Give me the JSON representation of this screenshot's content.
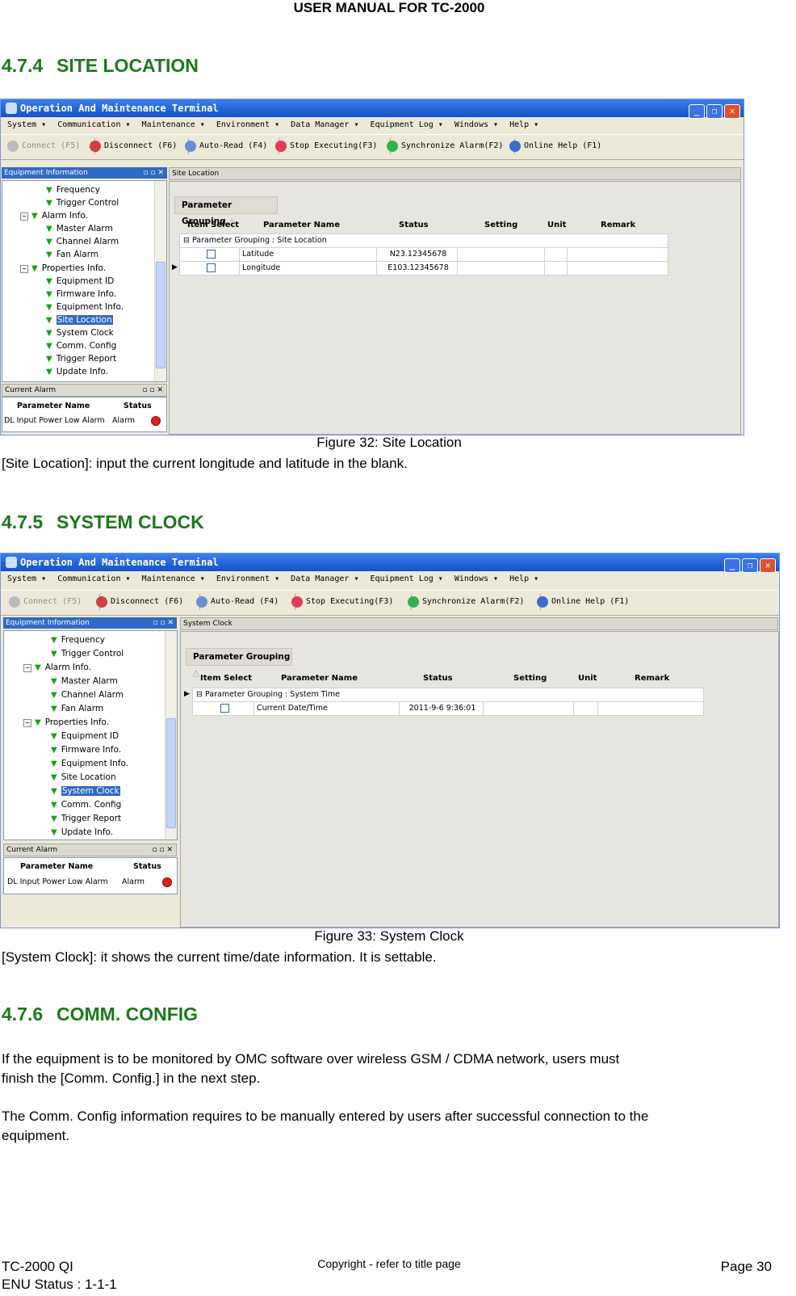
{
  "header": {
    "title": "USER MANUAL FOR TC-2000"
  },
  "sections": [
    {
      "number": "4.7.4",
      "title": "SITE LOCATION"
    },
    {
      "number": "4.7.5",
      "title": "SYSTEM CLOCK"
    },
    {
      "number": "4.7.6",
      "title": "COMM. CONFIG"
    }
  ],
  "captions": {
    "fig32": "Figure 32: Site Location",
    "fig33": "Figure 33: System Clock"
  },
  "paragraphs": {
    "site_location": "[Site Location]: input the current longitude and latitude in the blank.",
    "system_clock": "[System Clock]: it shows the current time/date information. It is settable.",
    "comm_config_1a": "If the equipment is to be monitored by OMC software over wireless GSM / CDMA network, users must",
    "comm_config_1b": "finish the [Comm. Config.] in the next step.",
    "comm_config_2a": "The Comm. Config information requires to be manually entered by users after successful connection to the",
    "comm_config_2b": "equipment."
  },
  "app": {
    "title": "Operation And Maintenance Terminal",
    "menu": [
      "System ▾",
      "Communication ▾",
      "Maintenance ▾",
      "Environment ▾",
      "Data Manager ▾",
      "Equipment Log ▾",
      "Windows ▾",
      "Help ▾"
    ],
    "toolbar": {
      "connect": "Connect (F5)",
      "disconnect": "Disconnect (F6)",
      "auto_read": "Auto-Read (F4)",
      "stop": "Stop Executing(F3)",
      "sync": "Synchronize Alarm(F2)",
      "help": "Online Help (F1)"
    },
    "equipment_panel": "Equipment Information",
    "tree": {
      "frequency": "Frequency",
      "trigger_control": "Trigger Control",
      "alarm_info": "Alarm Info.",
      "master_alarm": "Master Alarm",
      "channel_alarm": "Channel Alarm",
      "fan_alarm": "Fan Alarm",
      "properties_info": "Properties Info.",
      "equipment_id": "Equipment ID",
      "firmware_info": "Firmware Info.",
      "equipment_info": "Equipment Info.",
      "site_location": "Site Location",
      "system_clock": "System Clock",
      "comm_config": "Comm. Config",
      "trigger_report": "Trigger Report",
      "update_info": "Update Info."
    },
    "current_alarm": {
      "title": "Current Alarm",
      "col_name": "Parameter Name",
      "col_status": "Status",
      "row_name": "DL Input Power Low Alarm",
      "row_status": "Alarm"
    },
    "grid_headers": {
      "grouping": "Parameter Grouping",
      "item_select": "Item Select",
      "param_name": "Parameter Name",
      "status": "Status",
      "setting": "Setting",
      "unit": "Unit",
      "remark": "Remark"
    },
    "shot1": {
      "tab": "Site Location",
      "group_row": "Parameter Grouping : Site Location",
      "rows": [
        {
          "name": "Latitude",
          "status": "N23.12345678"
        },
        {
          "name": "Longitude",
          "status": "E103.12345678"
        }
      ]
    },
    "shot2": {
      "tab": "System Clock",
      "group_row": "Parameter Grouping : System Time",
      "rows": [
        {
          "name": "Current Date/Time",
          "status": "2011-9-6 9:36:01"
        }
      ]
    }
  },
  "footer": {
    "doc": "TC-2000 QI",
    "status": "ENU Status : 1-1-1",
    "copyright": "Copyright - refer to title page",
    "page": "Page 30"
  }
}
